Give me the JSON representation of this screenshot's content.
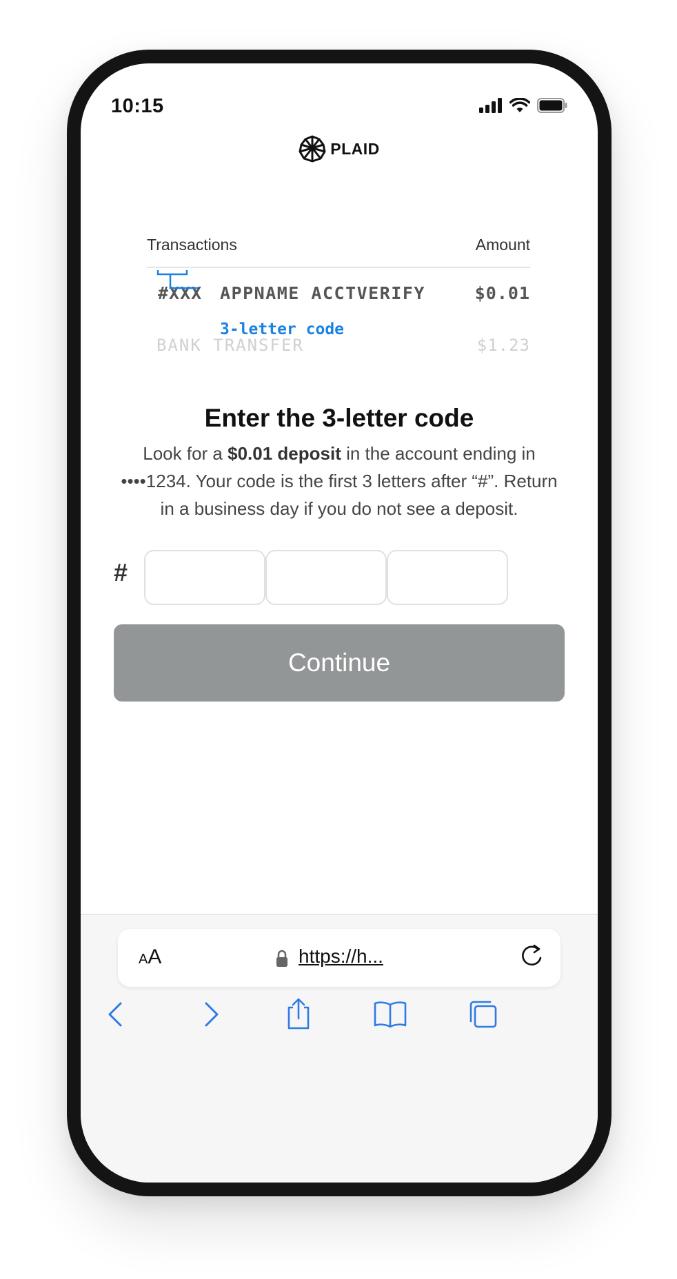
{
  "status": {
    "time": "10:15"
  },
  "logo": {
    "text": "PLAID"
  },
  "transactions": {
    "header_left": "Transactions",
    "header_right": "Amount",
    "row1": {
      "code": "#XXX",
      "description": "APPNAME ACCTVERIFY",
      "amount": "$0.01"
    },
    "code_hint": "3-letter code",
    "row2": {
      "description": "BANK TRANSFER",
      "amount": "$1.23"
    }
  },
  "heading": "Enter the 3-letter code",
  "description": {
    "part1": "Look for a ",
    "bold": "$0.01 deposit",
    "part2": " in the account ending in ••••1234. Your code is the first 3 letters after “#”. Return in a business day if you do not see a deposit."
  },
  "code_input": {
    "prefix": "#",
    "box1": "",
    "box2": "",
    "box3": ""
  },
  "continue_label": "Continue",
  "browser": {
    "text_size_label_small": "A",
    "text_size_label_big": "A",
    "url": "https://h..."
  },
  "colors": {
    "accent": "#1a82e2",
    "button_disabled": "#939697",
    "ios_blue": "#2f7ae5"
  }
}
